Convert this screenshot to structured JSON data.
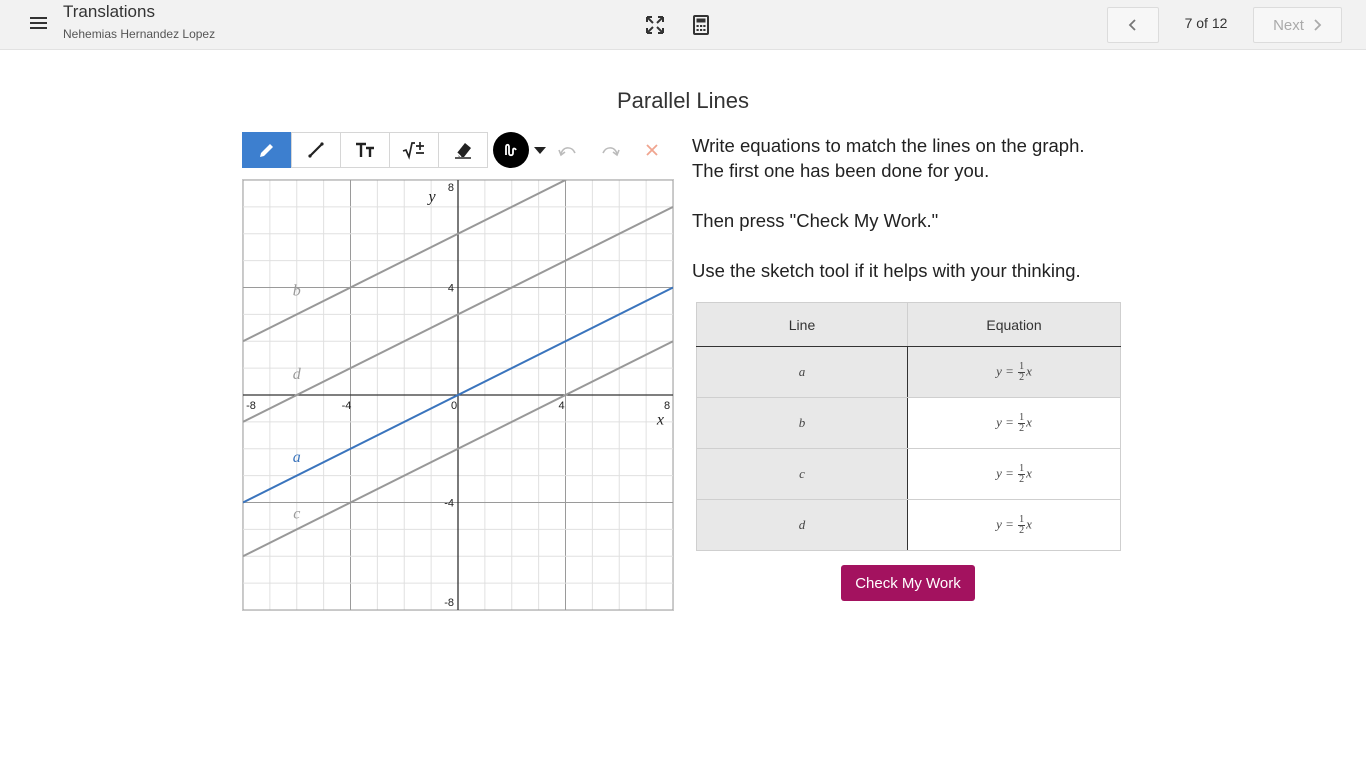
{
  "header": {
    "title": "Translations",
    "user_name": "Nehemias Hernandez Lopez",
    "page_count": "7 of 12",
    "next_label": "Next",
    "icons": [
      "menu-icon",
      "expand-icon",
      "calculator-icon",
      "chevron-left-icon",
      "chevron-right-icon"
    ]
  },
  "main": {
    "heading": "Parallel Lines",
    "instructions": [
      "Write equations to match the lines on the graph.",
      "The first one has been done for you.",
      "Then press \"Check My Work.\"",
      "Use the sketch tool if it helps with your thinking."
    ],
    "toolbar": {
      "tools": [
        "pencil-icon",
        "line-icon",
        "text-icon",
        "math-icon",
        "eraser-icon"
      ],
      "active_tool": "pencil-icon",
      "color": "#000000",
      "actions": [
        "undo-icon",
        "redo-icon",
        "clear-icon"
      ]
    },
    "table": {
      "headers": [
        "Line",
        "Equation"
      ],
      "rows": [
        {
          "line": "a",
          "eq_prefix": "y =",
          "eq_num": "1",
          "eq_den": "2",
          "eq_suffix": "x"
        },
        {
          "line": "b",
          "eq_prefix": "y =",
          "eq_num": "1",
          "eq_den": "2",
          "eq_suffix": "x"
        },
        {
          "line": "c",
          "eq_prefix": "y =",
          "eq_num": "1",
          "eq_den": "2",
          "eq_suffix": "x"
        },
        {
          "line": "d",
          "eq_prefix": "y =",
          "eq_num": "1",
          "eq_den": "2",
          "eq_suffix": "x"
        }
      ]
    },
    "check_button": "Check My Work"
  },
  "chart_data": {
    "type": "line",
    "xlabel": "x",
    "ylabel": "y",
    "xlim": [
      -8,
      8
    ],
    "ylim": [
      -8,
      8
    ],
    "x_ticks": [
      "-8",
      "-4",
      "0",
      "4",
      "8"
    ],
    "y_ticks": [
      "8",
      "4",
      "-4",
      "-8"
    ],
    "grid": true,
    "series": [
      {
        "name": "a",
        "slope": 0.5,
        "intercept": 0,
        "color": "#3a74bd"
      },
      {
        "name": "b",
        "slope": 0.5,
        "intercept": 6,
        "color": "#999999"
      },
      {
        "name": "c",
        "slope": 0.5,
        "intercept": -2,
        "color": "#999999"
      },
      {
        "name": "d",
        "slope": 0.5,
        "intercept": 3,
        "color": "#999999"
      }
    ]
  }
}
